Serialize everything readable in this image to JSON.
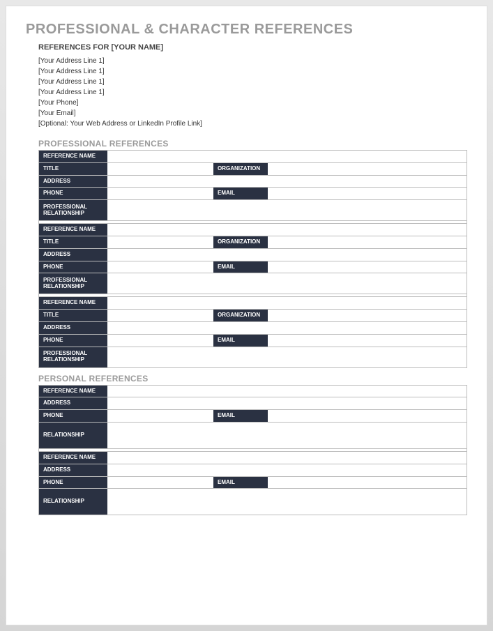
{
  "title": "PROFESSIONAL & CHARACTER REFERENCES",
  "subtitle": "REFERENCES FOR [YOUR NAME]",
  "info": {
    "addr1": "[Your Address Line 1]",
    "addr2": "[Your Address Line 1]",
    "addr3": "[Your Address Line 1]",
    "addr4": "[Your Address Line 1]",
    "phone": "[Your Phone]",
    "email": "[Your Email]",
    "web": "[Optional: Your Web Address or LinkedIn Profile Link]"
  },
  "sections": {
    "prof_heading": "PROFESSIONAL REFERENCES",
    "pers_heading": "PERSONAL REFERENCES"
  },
  "labels": {
    "ref_name": "REFERENCE NAME",
    "title": "TITLE",
    "organization": "ORGANIZATION",
    "address": "ADDRESS",
    "phone": "PHONE",
    "email": "EMAIL",
    "prof_rel": "PROFESSIONAL RELATIONSHIP",
    "relationship": "RELATIONSHIP"
  }
}
